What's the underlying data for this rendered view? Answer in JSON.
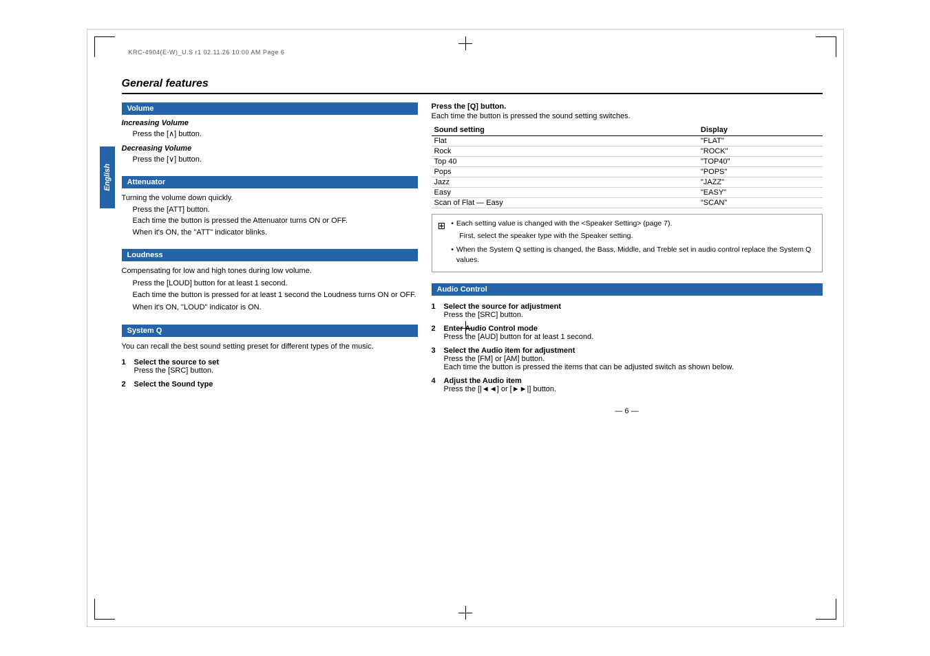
{
  "crop_text": "KRC-4904(E-W)_U.S r1   02.11.26   10:00 AM   Page 6",
  "title": "General features",
  "sidebar_label": "English",
  "sections": {
    "volume": {
      "header": "Volume",
      "increasing": {
        "title": "Increasing Volume",
        "text": "Press the [∧] button."
      },
      "decreasing": {
        "title": "Decreasing Volume",
        "text": "Press the [∨] button."
      }
    },
    "attenuator": {
      "header": "Attenuator",
      "intro": "Turning the volume down quickly.",
      "lines": [
        "Press the [ATT] button.",
        "Each time the button is pressed the Attenuator turns ON or OFF.",
        "When it's ON, the \"ATT\" indicator blinks."
      ]
    },
    "loudness": {
      "header": "Loudness",
      "intro": "Compensating for low and high tones during low volume.",
      "lines": [
        "Press the [LOUD] button for at least 1 second.",
        "Each time the button is pressed for at least 1 second the Loudness turns ON or OFF.",
        "When it's ON, \"LOUD\" indicator is ON."
      ]
    },
    "system_q": {
      "header": "System Q",
      "intro": "You can recall the best sound setting preset for different types of the music.",
      "steps": [
        {
          "num": "1",
          "title": "Select the source to set",
          "text": "Press the [SRC] button."
        },
        {
          "num": "2",
          "title": "Select the Sound type",
          "text": ""
        }
      ],
      "press_q_btn": "Press the [Q] button.",
      "press_q_desc": "Each time the button is pressed the sound setting switches.",
      "table_headers": [
        "Sound setting",
        "Display"
      ],
      "table_rows": [
        [
          "Flat",
          "\"FLAT\""
        ],
        [
          "Rock",
          "\"ROCK\""
        ],
        [
          "Top 40",
          "\"TOP40\""
        ],
        [
          "Pops",
          "\"POPS\""
        ],
        [
          "Jazz",
          "\"JAZZ\""
        ],
        [
          "Easy",
          "\"EASY\""
        ],
        [
          "Scan of Flat — Easy",
          "\"SCAN\""
        ]
      ],
      "notes": [
        "Each setting value is changed with the <Speaker Setting> (page 7).",
        "First, select the speaker type with the Speaker setting.",
        "When the System Q setting is changed, the Bass, Middle, and Treble set in audio control replace the System Q values."
      ]
    },
    "audio_control": {
      "header": "Audio Control",
      "steps": [
        {
          "num": "1",
          "title": "Select the source for adjustment",
          "text": "Press the [SRC] button."
        },
        {
          "num": "2",
          "title": "Enter Audio Control mode",
          "text": "Press the [AUD] button for at least 1 second."
        },
        {
          "num": "3",
          "title": "Select the Audio item for adjustment",
          "text": "Press the [FM] or [AM] button.",
          "extra": "Each time the button is pressed the items that can be adjusted switch as shown below."
        },
        {
          "num": "4",
          "title": "Adjust the Audio item",
          "text": "Press the [|◄◄] or [►►|] button."
        }
      ]
    }
  },
  "page_number": "— 6 —"
}
